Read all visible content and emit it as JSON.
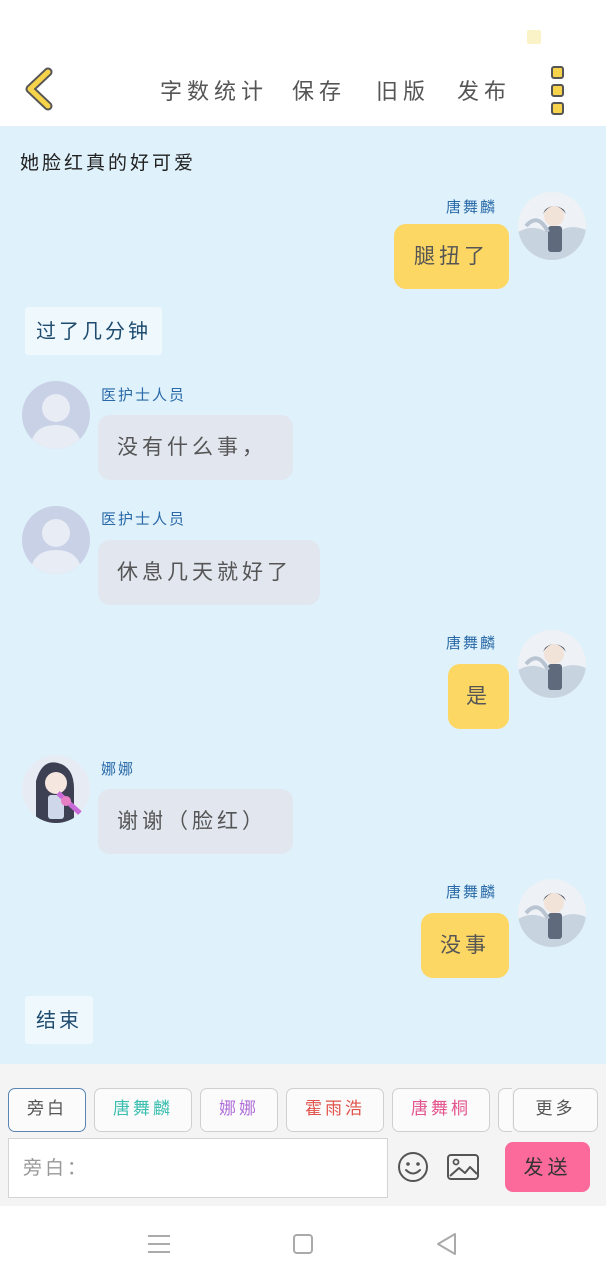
{
  "header": {
    "back_icon": "chevron-left-icon",
    "actions": [
      "字数统计",
      "保存",
      "旧版",
      "发布"
    ],
    "menu_icon": "more-vertical-icon"
  },
  "chat": {
    "narration_top": "她脸红真的好可爱",
    "messages": [
      {
        "type": "self",
        "name": "唐舞麟",
        "text": "腿扭了"
      },
      {
        "type": "aside",
        "text": "过了几分钟"
      },
      {
        "type": "other",
        "name": "医护士人员",
        "text": "没有什么事，"
      },
      {
        "type": "other",
        "name": "医护士人员",
        "text": "休息几天就好了"
      },
      {
        "type": "self",
        "name": "唐舞麟",
        "text": "是"
      },
      {
        "type": "other",
        "name": "娜娜",
        "text": "谢谢（脸红）"
      },
      {
        "type": "self",
        "name": "唐舞麟",
        "text": "没事"
      },
      {
        "type": "aside",
        "text": "结束"
      }
    ]
  },
  "roles": [
    {
      "label": "旁白",
      "color": "#555555"
    },
    {
      "label": "唐舞麟",
      "color": "#3bbfb0"
    },
    {
      "label": "娜娜",
      "color": "#b06fd8"
    },
    {
      "label": "霍雨浩",
      "color": "#e0524a"
    },
    {
      "label": "唐舞桐",
      "color": "#e3558e"
    }
  ],
  "more_label": "更多",
  "input": {
    "placeholder": "旁白："
  },
  "send_label": "发送",
  "icons": [
    "emoji-icon",
    "image-icon"
  ],
  "nav": [
    "menu-icon",
    "home-square-icon",
    "back-triangle-icon"
  ],
  "colors": {
    "chat_bg": "#dff1fb",
    "self_bubble": "#fdd763",
    "other_bubble": "#e1e6ef",
    "send": "#fb6a9a",
    "accent": "#f6d34a"
  }
}
